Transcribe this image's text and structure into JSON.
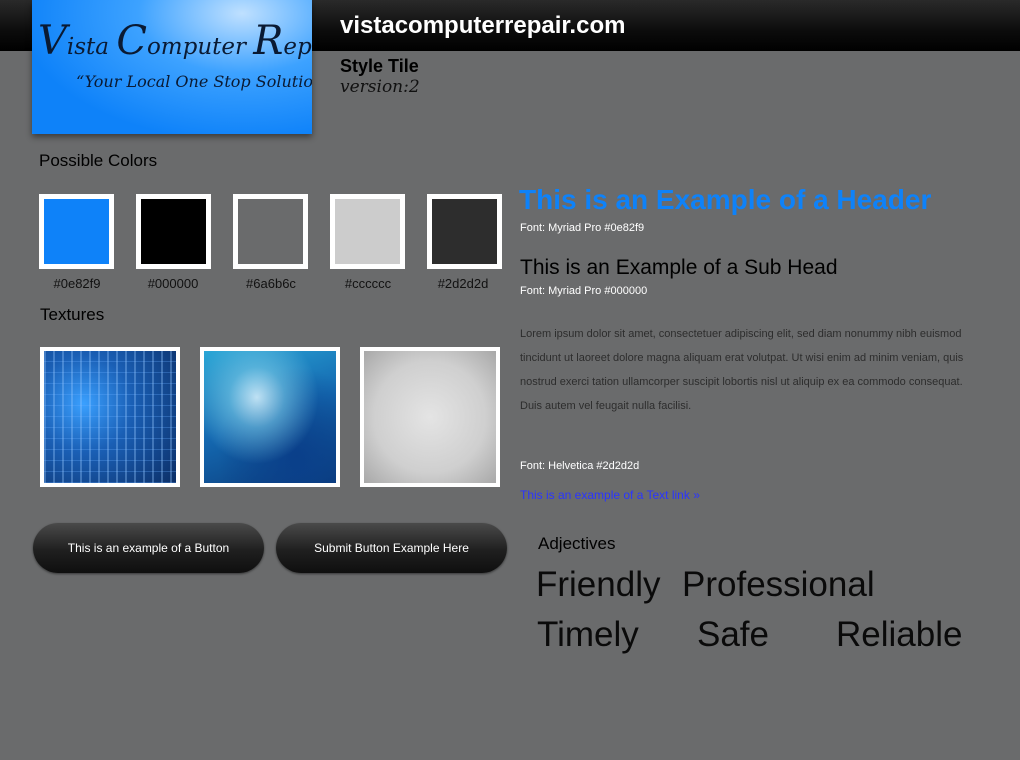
{
  "header": {
    "site_url": "vistacomputerrepair.com",
    "style_tile": "Style Tile",
    "version": "version:2"
  },
  "logo": {
    "title_parts": [
      {
        "cap": "V",
        "rest": "ista "
      },
      {
        "cap": "C",
        "rest": "omputer "
      },
      {
        "cap": "R",
        "rest": "epair"
      }
    ],
    "tagline": "“Your Local One Stop Solution”"
  },
  "colors": {
    "title": "Possible Colors",
    "swatches": [
      {
        "label": "#0e82f9",
        "hex": "#0e82f9"
      },
      {
        "label": "#000000",
        "hex": "#000000"
      },
      {
        "label": "#6a6b6c",
        "hex": "#6a6b6c"
      },
      {
        "label": "#cccccc",
        "hex": "#cccccc"
      },
      {
        "label": "#2d2d2d",
        "hex": "#2d2d2d"
      }
    ]
  },
  "textures": {
    "title": "Textures",
    "items": [
      "circuit-board-texture",
      "blue-grunge-texture",
      "gray-paper-texture"
    ]
  },
  "typography": {
    "header_example": "This is an Example of a Header",
    "header_font": "Font: Myriad Pro #0e82f9",
    "subhead_example": "This is an Example of a Sub Head",
    "subhead_font": "Font: Myriad Pro #000000",
    "body_text": "Lorem ipsum dolor sit amet, consectetuer adipiscing elit, sed diam nonummy nibh euismod tincidunt ut laoreet dolore magna aliquam erat volutpat. Ut wisi enim ad minim veniam, quis nostrud exerci tation ullamcorper suscipit lobortis nisl ut aliquip ex ea commodo consequat. Duis autem vel feugait nulla facilisi.",
    "body_font": "Font: Helvetica #2d2d2d",
    "text_link": "This is an example of a Text link »"
  },
  "buttons": {
    "button_1": "This is an example of a Button",
    "button_2": "Submit Button Example Here"
  },
  "adjectives": {
    "title": "Adjectives",
    "words": [
      "Friendly",
      "Professional",
      "Timely",
      "Safe",
      "Reliable"
    ]
  }
}
